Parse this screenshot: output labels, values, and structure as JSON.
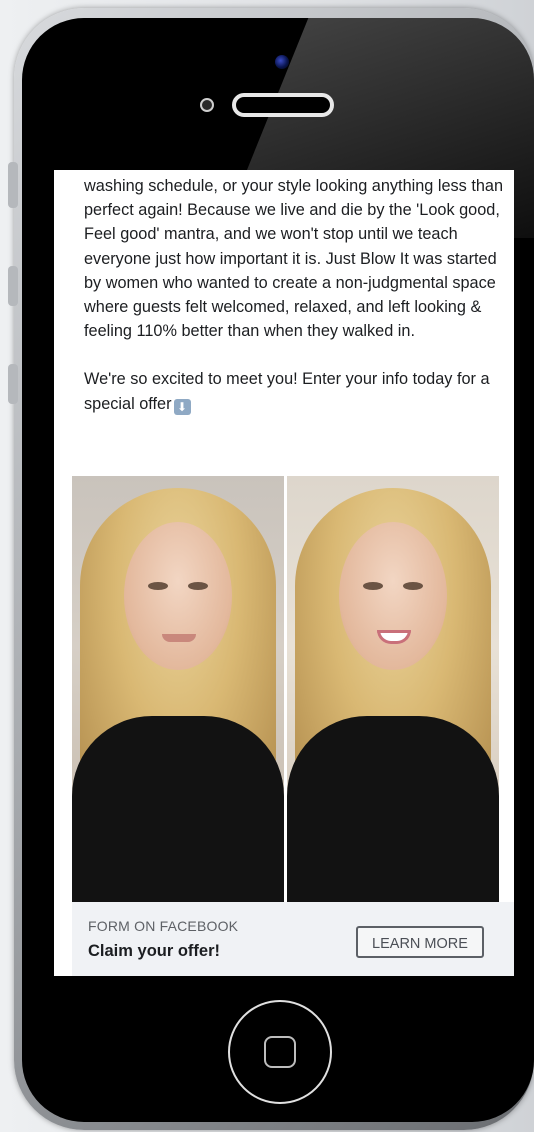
{
  "post": {
    "paragraph_1": "washing schedule, or your style looking anything less than perfect again! Because we live and die by the 'Look good, Feel good' mantra, and we won't stop until we teach everyone just how important it is. Just Blow It was started by women who wanted to create a non-judgmental space where guests felt welcomed, relaxed, and left looking & feeling 110% better than when they walked in.",
    "paragraph_2": "We're so excited to meet you! Enter your info today for a special offer",
    "emoji_icon": "down-arrow-emoji-icon",
    "emoji_glyph": "⬇"
  },
  "images": {
    "before": "woman-before-photo",
    "after": "woman-after-photo"
  },
  "cta": {
    "source": "FORM ON FACEBOOK",
    "title": "Claim your offer!",
    "button_label": "LEARN MORE"
  },
  "colors": {
    "text": "#1c1e21",
    "cta_background": "#f0f2f5",
    "button_border": "#5c6066"
  }
}
